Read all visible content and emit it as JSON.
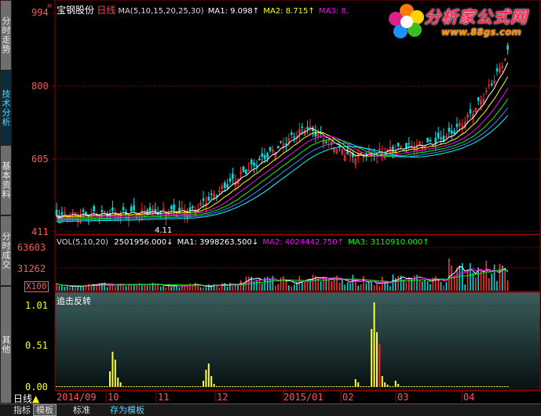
{
  "sidebar": {
    "tabs": [
      {
        "label": "分时走势",
        "active": false
      },
      {
        "label": "技术分析",
        "active": true
      },
      {
        "label": "基本资料",
        "active": false
      },
      {
        "label": "分时成交",
        "active": false
      },
      {
        "label": "其他",
        "active": false
      }
    ]
  },
  "price_panel": {
    "stock_name": "宝钢股份",
    "period": "日线",
    "ma_params": "MA(5,10,15,20,25,30)",
    "ma1_label": "MA1:",
    "ma1_value": "9.098↑",
    "ma2_label": "MA2:",
    "ma2_value": "8.715↑",
    "ma3_label": "MA3:",
    "ma3_value": "8.",
    "y_ticks": [
      "994",
      "800",
      "605",
      "411"
    ],
    "low_marker": "4.11"
  },
  "volume_panel": {
    "params": "VOL(5,10,20)",
    "value": "2501956.000↓",
    "ma1_label": "MA1:",
    "ma1_value": "3998263.500↓",
    "ma2_label": "MA2:",
    "ma2_value": "4024442.750↑",
    "ma3_label": "MA3:",
    "ma3_value": "3110910.000↑",
    "y_ticks": [
      "63603",
      "31262",
      "X100"
    ]
  },
  "indicator_panel": {
    "name": "追击反转",
    "y_ticks": [
      "1.01",
      "0.51",
      "0.00"
    ]
  },
  "date_axis": {
    "period_label": "日线",
    "labels": [
      "2014/09",
      "10",
      "11",
      "12",
      "2015/01",
      "02",
      "03",
      "04"
    ]
  },
  "bottom_tabs": [
    "指标",
    "模板",
    "标准",
    "存为模板"
  ],
  "logo": {
    "title": "分析家公式网",
    "url": "www.88gs.com"
  },
  "colors": {
    "background": "#000000",
    "grid": "#8b0000",
    "axis_text": "#ff5555",
    "ma1": "#ffffff",
    "ma2": "#ffff00",
    "ma3": "#ff00ff",
    "ma4": "#00ff00",
    "ma5": "#4488ff",
    "ma6": "#00ffff",
    "candle_up": "#ff3333",
    "candle_down": "#00dddd"
  }
}
